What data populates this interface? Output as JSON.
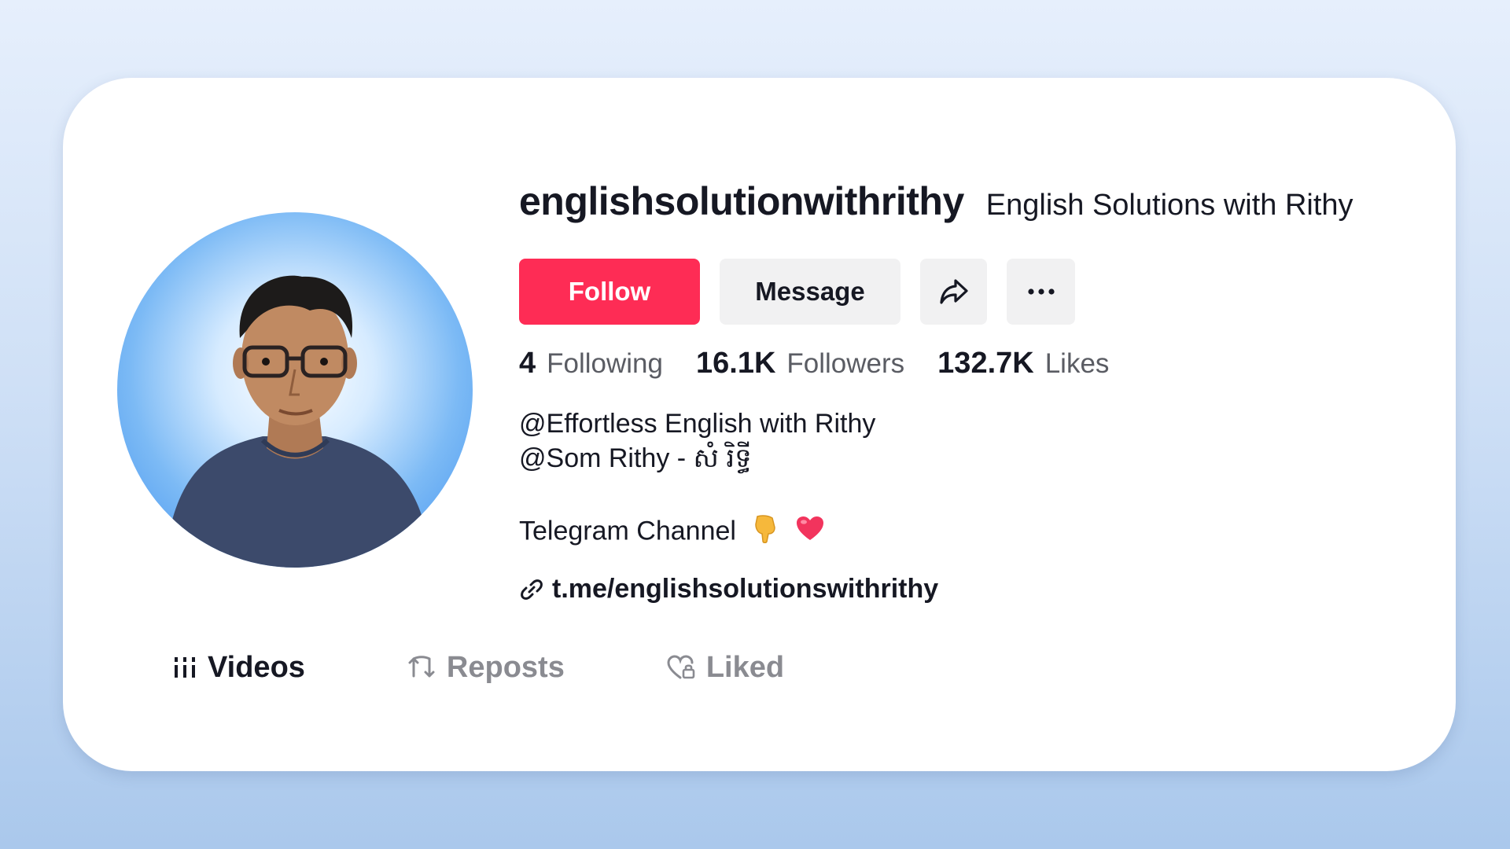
{
  "profile": {
    "username": "englishsolutionwithrithy",
    "display_name": "English Solutions with Rithy"
  },
  "actions": {
    "follow_label": "Follow",
    "message_label": "Message",
    "share_icon": "share-icon",
    "more_icon": "more-icon"
  },
  "stats": {
    "following_count": "4",
    "following_label": "Following",
    "followers_count": "16.1K",
    "followers_label": "Followers",
    "likes_count": "132.7K",
    "likes_label": "Likes"
  },
  "bio": {
    "line1": "@Effortless English with Rithy",
    "line2": "@Som Rithy - សំ រិទ្ធី",
    "line3": "Telegram Channel",
    "emoji_icons": [
      "pointing-down-icon",
      "heart-icon"
    ]
  },
  "link": {
    "text": "t.me/englishsolutionswithrithy",
    "icon": "link-icon"
  },
  "tabs": [
    {
      "label": "Videos",
      "icon": "grid-icon",
      "active": true
    },
    {
      "label": "Reposts",
      "icon": "repost-icon",
      "active": false
    },
    {
      "label": "Liked",
      "icon": "heart-lock-icon",
      "active": false
    }
  ],
  "colors": {
    "follow_button": "#fe2c55",
    "secondary_button": "#f1f1f2",
    "text_primary": "#161823",
    "text_secondary": "#5a5c63"
  }
}
